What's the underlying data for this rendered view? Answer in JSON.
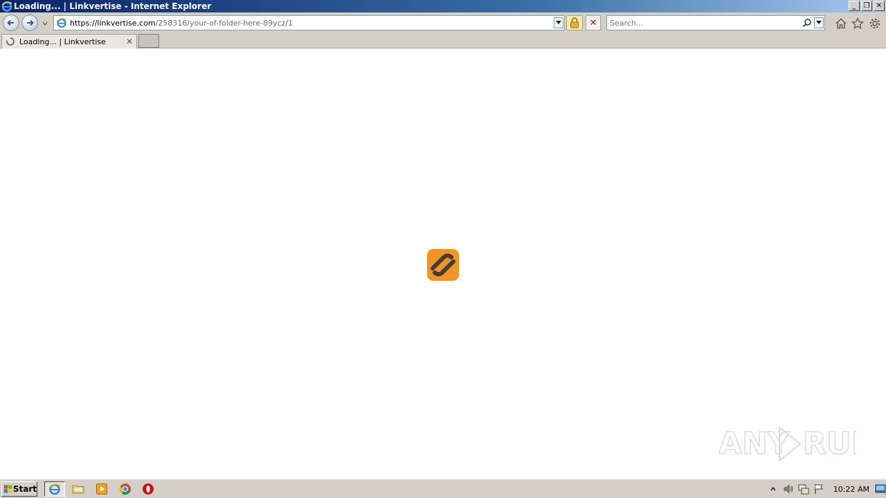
{
  "window": {
    "title": "Loading... | Linkvertise - Internet Explorer",
    "controls": {
      "minimize": "_",
      "restore": "❐",
      "close": "✕"
    }
  },
  "navbar": {
    "url_base": "https://linkvertise.com",
    "url_path": "/258316/your-of-folder-here-89ycz/1",
    "search_placeholder": "Search..."
  },
  "tabs": [
    {
      "label": "Loading... | Linkvertise",
      "close": "✕"
    }
  ],
  "content": {
    "loader_icon": "linkvertise-logo-icon",
    "watermark_text": "ANY RUN"
  },
  "taskbar": {
    "start_label": "Start",
    "items": [
      "internet-explorer-icon",
      "file-explorer-icon",
      "media-player-icon",
      "chrome-icon",
      "opera-icon"
    ],
    "clock": "10:22 AM"
  },
  "colors": {
    "accent_orange": "#f7931e",
    "logo_dark": "#3d3d3d"
  }
}
